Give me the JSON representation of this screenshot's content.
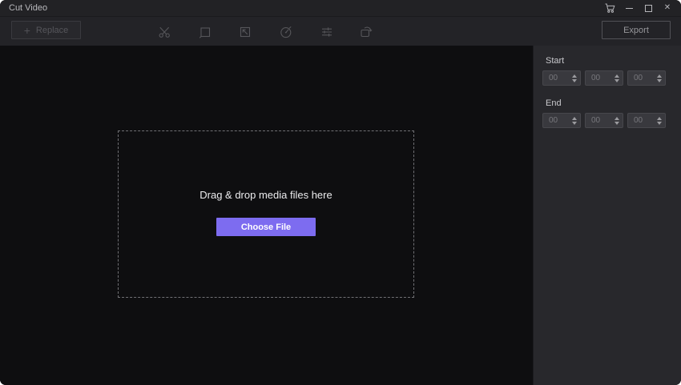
{
  "titlebar": {
    "title": "Cut Video",
    "icons": [
      "cart-icon",
      "minimize-icon",
      "maximize-icon",
      "close-icon"
    ]
  },
  "glyphs": {
    "close": "✕",
    "plus": "+"
  },
  "toolbar": {
    "replace": {
      "label": "Replace"
    },
    "tools": [
      {
        "name": "cut",
        "icon": "scissors-icon"
      },
      {
        "name": "crop",
        "icon": "crop-icon"
      },
      {
        "name": "resize",
        "icon": "resize-icon"
      },
      {
        "name": "speed",
        "icon": "speed-icon"
      },
      {
        "name": "adjust",
        "icon": "adjust-sliders-icon"
      },
      {
        "name": "rotate",
        "icon": "rotate-icon"
      }
    ],
    "export_label": "Export"
  },
  "main": {
    "dropzone": {
      "message": "Drag & drop media files here",
      "choose_file_label": "Choose File"
    }
  },
  "panel": {
    "start": {
      "label": "Start",
      "values": [
        "00",
        "00",
        "00"
      ]
    },
    "end": {
      "label": "End",
      "values": [
        "00",
        "00",
        "00"
      ]
    }
  },
  "colors": {
    "accent": "#7d6cf0",
    "canvas_bg": "#0e0e10",
    "panel_bg": "#28282c",
    "titlebar_bg": "#222225"
  }
}
